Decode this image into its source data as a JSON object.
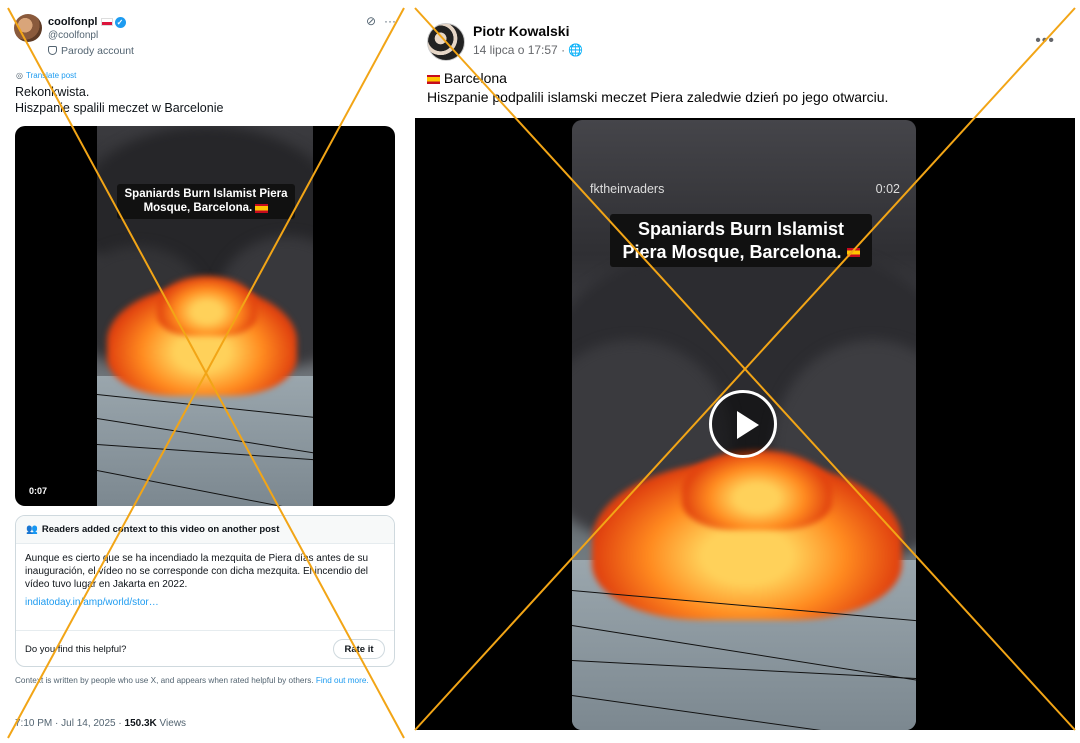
{
  "tweet": {
    "display_name": "coolfonpl",
    "handle": "@coolfonpl",
    "parody_label": "Parody account",
    "translate_label": "Translate post",
    "text_line1": "Rekonkwista.",
    "text_line2": "Hiszpanie spalili meczet w Barcelonie",
    "video_caption": "Spaniards Burn Islamist Piera Mosque, Barcelona.",
    "video_time": "0:07",
    "community_note": {
      "header": "Readers added context to this video on another post",
      "body": "Aunque es cierto que se ha incendiado la mezquita de Piera días antes de su inauguración, el vídeo no se corresponde con dicha mezquita. El incendio del vídeo tuvo lugar en Jakarta en 2022.",
      "link": "indiatoday.in/amp/world/stor…",
      "helpful_question": "Do you find this helpful?",
      "rate_button": "Rate it"
    },
    "context_footer": "Context is written by people who use X, and appears when rated helpful by others.",
    "find_out_more": "Find out more.",
    "timestamp": "7:10 PM · Jul 14, 2025 ·",
    "views_count": "150.3K",
    "views_label": "Views"
  },
  "facebook": {
    "author": "Piotr Kowalski",
    "date": "14 lipca o 17:57 ·",
    "line1": "Barcelona",
    "line2": "Hiszpanie podpalili islamski meczet Piera zaledwie dzień po jego otwarciu.",
    "video_username": "fktheinvaders",
    "video_duration": "0:02",
    "video_caption": "Spaniards Burn Islamist Piera Mosque, Barcelona."
  },
  "colors": {
    "cross_lines": "#f2a516",
    "x_link": "#1d9bf0",
    "fb_text": "#050505"
  },
  "icons": [
    "verified-badge-icon",
    "grok-icon",
    "more-icon",
    "translate-icon",
    "people-icon",
    "globe-icon",
    "play-icon"
  ]
}
